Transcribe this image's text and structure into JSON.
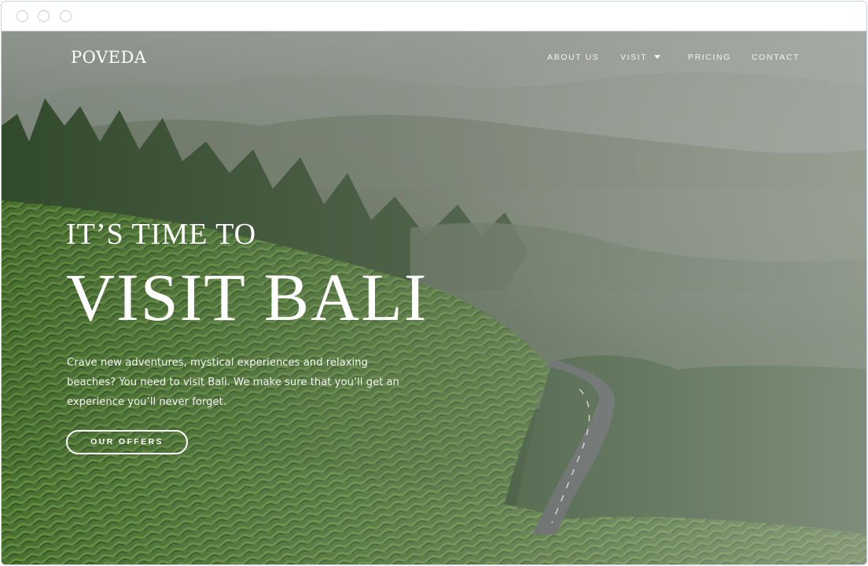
{
  "nav": {
    "logo": "POVEDA",
    "links": [
      {
        "label": "ABOUT US"
      },
      {
        "label": "VISIT",
        "has_dropdown": true,
        "icon": "caret-down-icon"
      },
      {
        "label": "PRICING"
      },
      {
        "label": "CONTACT"
      }
    ]
  },
  "hero": {
    "kicker": "IT’S TIME TO",
    "title": "VISIT BALI",
    "description_lines": [
      "Crave new adventures, mystical experiences and relaxing",
      "beaches? You need to visit Bali. We make sure that you’ll get an",
      "experience you’ll never forget."
    ],
    "cta_label": "OUR OFFERS"
  },
  "colors": {
    "window_border": "#c9d3ea",
    "text": "#ffffff",
    "foliage_dark": "#2f4a28",
    "fog": "#a7ada6"
  }
}
